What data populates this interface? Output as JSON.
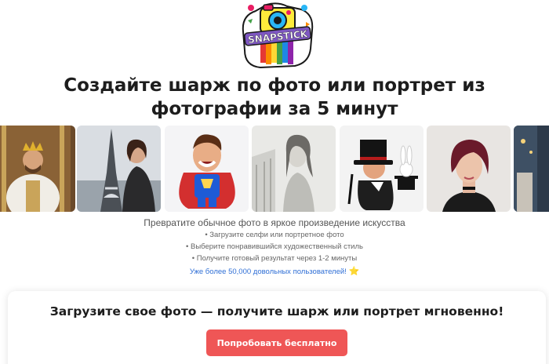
{
  "logo": {
    "text": "SNAPSTICK",
    "icon": "camera-sticker-logo"
  },
  "headline": "Создайте шарж по фото или портрет из фотографии за 5 минут",
  "gallery": {
    "items": [
      {
        "name": "king-portrait",
        "icon": "king-image"
      },
      {
        "name": "eiffel-tower-portrait",
        "icon": "paris-image"
      },
      {
        "name": "superhero-caricature",
        "icon": "superhero-image"
      },
      {
        "name": "sketch-portrait",
        "icon": "sketch-image"
      },
      {
        "name": "magician-caricature",
        "icon": "magician-image"
      },
      {
        "name": "woman-portrait",
        "icon": "woman-image"
      },
      {
        "name": "partial-portrait",
        "icon": "partial-image"
      }
    ]
  },
  "features": {
    "tagline": "Превратите обычное фото в яркое произведение искусства",
    "bullets": [
      "Загрузите селфи или портретное фото",
      "Выберите понравившийся художественный стиль",
      "Получите готовый результат через 1-2 минуты"
    ],
    "users": "Уже более 50,000 довольных пользователей!",
    "users_icon": "⭐"
  },
  "cta": {
    "title": "Загрузите свое фото — получите шарж или портрет мгновенно!",
    "button": "Попробовать бесплатно",
    "button_color": "#ef5656"
  }
}
